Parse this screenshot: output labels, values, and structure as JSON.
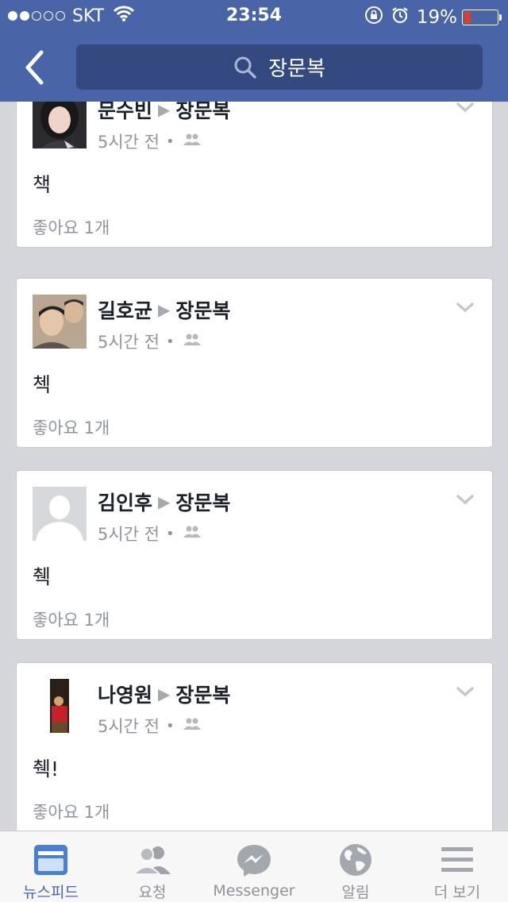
{
  "status_bar": {
    "carrier": "SKT",
    "time": "23:54",
    "battery_percent_label": "19%",
    "battery_level": 0.19,
    "signal_bars_filled": 2,
    "signal_bars_total": 5
  },
  "header": {
    "search_text": "장문복",
    "accent_color": "#4a64a8"
  },
  "posts": [
    {
      "author": "문수빈",
      "target": "장문복",
      "time": "5시간 전",
      "text": "책",
      "likes": "좋아요 1개",
      "avatar": "photo-avatar"
    },
    {
      "author": "길호균",
      "target": "장문복",
      "time": "5시간 전",
      "text": "첵",
      "likes": "좋아요 1개",
      "avatar": "photo-avatar"
    },
    {
      "author": "김인후",
      "target": "장문복",
      "time": "5시간 전",
      "text": "췍",
      "likes": "좋아요 1개",
      "avatar": "default-silhouette-avatar"
    },
    {
      "author": "나영원",
      "target": "장문복",
      "time": "5시간 전",
      "text": "췍!",
      "likes": "좋아요 1개",
      "avatar": "photo-avatar"
    }
  ],
  "tabs": [
    {
      "label": "뉴스피드",
      "icon": "news-feed-icon",
      "active": true
    },
    {
      "label": "요청",
      "icon": "friend-requests-icon",
      "active": false
    },
    {
      "label": "Messenger",
      "icon": "messenger-icon",
      "active": false
    },
    {
      "label": "알림",
      "icon": "globe-icon",
      "active": false
    },
    {
      "label": "더 보기",
      "icon": "menu-icon",
      "active": false
    }
  ]
}
